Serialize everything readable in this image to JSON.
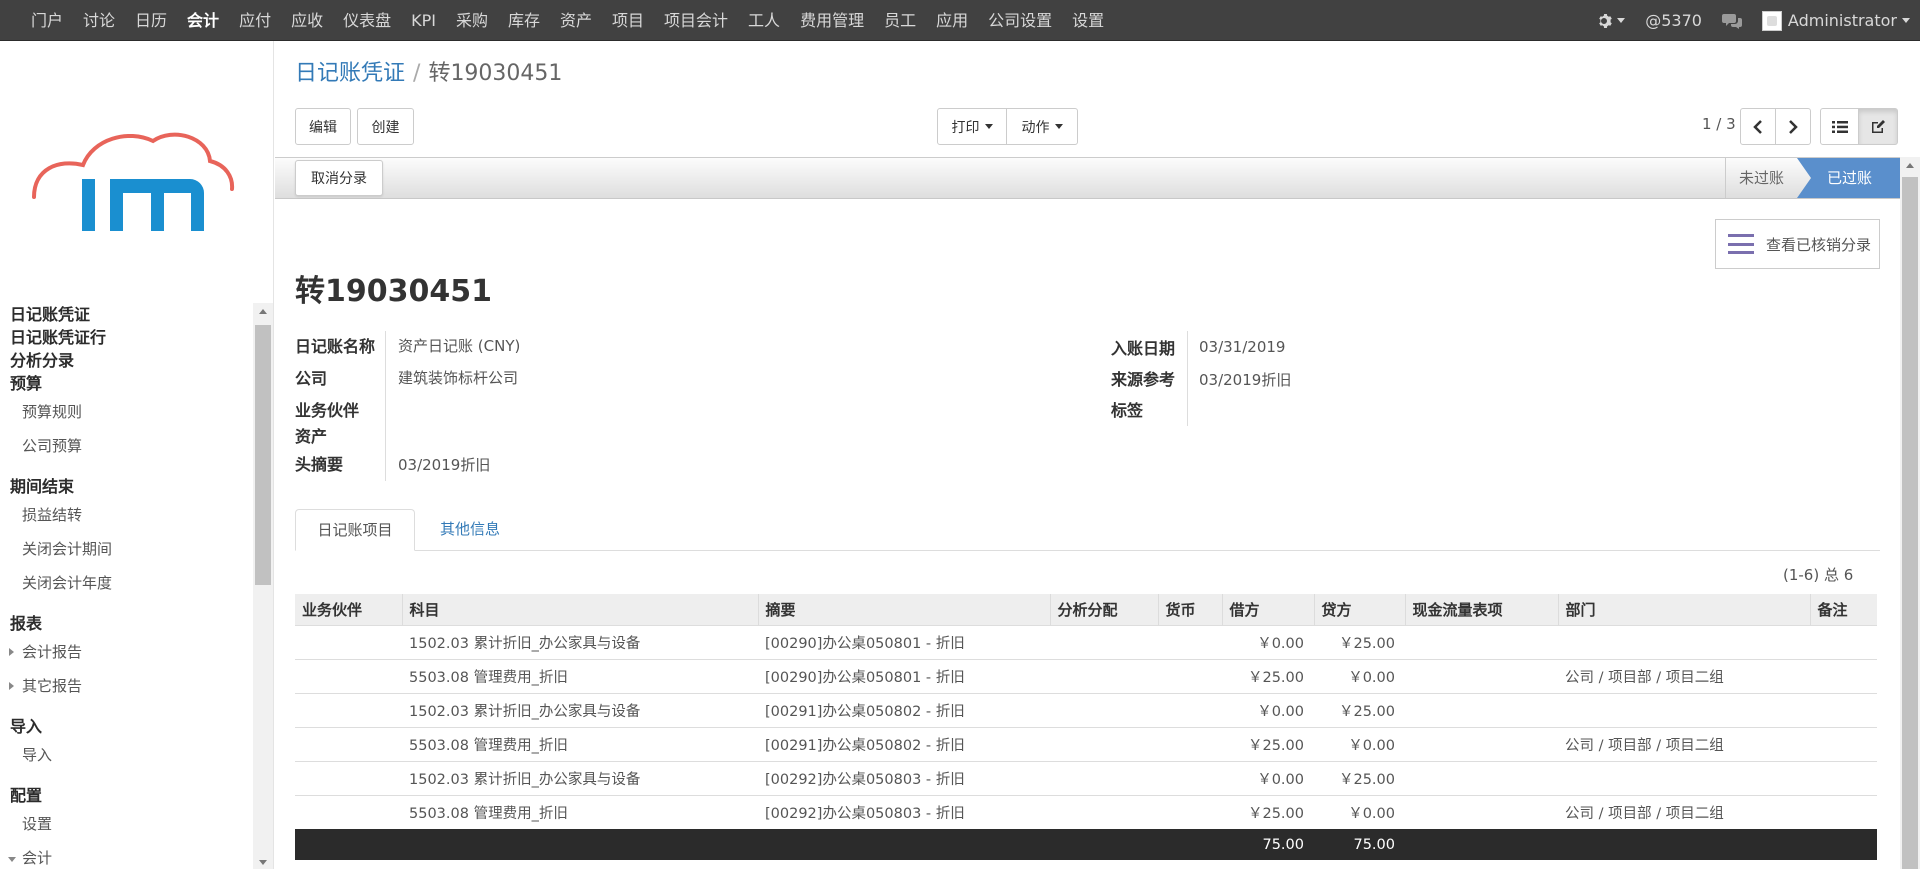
{
  "topnav": {
    "menu": [
      "门户",
      "讨论",
      "日历",
      "会计",
      "应付",
      "应收",
      "仪表盘",
      "KPI",
      "采购",
      "库存",
      "资产",
      "项目",
      "项目会计",
      "工人",
      "费用管理",
      "员工",
      "应用",
      "公司设置",
      "设置"
    ],
    "active": "会计",
    "notification_count": "@5370",
    "user": "Administrator"
  },
  "sidebar": {
    "items": [
      {
        "label": "日记账凭证",
        "type": "header"
      },
      {
        "label": "日记账凭证行",
        "type": "header"
      },
      {
        "label": "分析分录",
        "type": "header"
      },
      {
        "label": "预算",
        "type": "header"
      },
      {
        "label": "预算规则",
        "type": "item"
      },
      {
        "label": "公司预算",
        "type": "item"
      },
      {
        "label": "期间结束",
        "type": "header"
      },
      {
        "label": "损益结转",
        "type": "item"
      },
      {
        "label": "关闭会计期间",
        "type": "item"
      },
      {
        "label": "关闭会计年度",
        "type": "item"
      },
      {
        "label": "报表",
        "type": "header"
      },
      {
        "label": "会计报告",
        "type": "item"
      },
      {
        "label": "其它报告",
        "type": "item"
      },
      {
        "label": "导入",
        "type": "header"
      },
      {
        "label": "导入",
        "type": "item"
      },
      {
        "label": "配置",
        "type": "header"
      },
      {
        "label": "设置",
        "type": "item"
      },
      {
        "label": "会计",
        "type": "item"
      }
    ]
  },
  "breadcrumb": {
    "parent": "日记账凭证",
    "separator": "/",
    "current": "转19030451"
  },
  "toolbar": {
    "edit": "编辑",
    "create": "创建",
    "print": "打印",
    "action": "动作",
    "pager": "1 / 3"
  },
  "statusbar": {
    "unreconcile": "取消分录",
    "states": [
      "未过账",
      "已过账"
    ],
    "active_state": "已过账"
  },
  "sheet": {
    "reconciled_button": "查看已核销分录",
    "title": "转19030451",
    "left_fields": [
      {
        "label": "日记账名称",
        "value": "资产日记账 (CNY)"
      },
      {
        "label": "公司",
        "value": "建筑装饰标杆公司"
      },
      {
        "label": "业务伙伴",
        "value": ""
      },
      {
        "label": "资产",
        "value": ""
      },
      {
        "label": "头摘要",
        "value": "03/2019折旧"
      }
    ],
    "right_fields": [
      {
        "label": "入账日期",
        "value": "03/31/2019"
      },
      {
        "label": "来源参考",
        "value": "03/2019折旧"
      },
      {
        "label": "标签",
        "value": ""
      }
    ]
  },
  "tabs": [
    "日记账项目",
    "其他信息"
  ],
  "record_count": "(1-6) 总 6",
  "table": {
    "columns": [
      "业务伙伴",
      "科目",
      "摘要",
      "分析分配",
      "货币",
      "借方",
      "贷方",
      "现金流量表项",
      "部门",
      "备注"
    ],
    "rows": [
      [
        "",
        "1502.03 累计折旧_办公家具与设备",
        "[00290]办公桌050801 - 折旧",
        "",
        "",
        "￥0.00",
        "￥25.00",
        "",
        "",
        ""
      ],
      [
        "",
        "5503.08 管理费用_折旧",
        "[00290]办公桌050801 - 折旧",
        "",
        "",
        "￥25.00",
        "￥0.00",
        "",
        "公司 / 项目部 / 项目二组",
        ""
      ],
      [
        "",
        "1502.03 累计折旧_办公家具与设备",
        "[00291]办公桌050802 - 折旧",
        "",
        "",
        "￥0.00",
        "￥25.00",
        "",
        "",
        ""
      ],
      [
        "",
        "5503.08 管理费用_折旧",
        "[00291]办公桌050802 - 折旧",
        "",
        "",
        "￥25.00",
        "￥0.00",
        "",
        "公司 / 项目部 / 项目二组",
        ""
      ],
      [
        "",
        "1502.03 累计折旧_办公家具与设备",
        "[00292]办公桌050803 - 折旧",
        "",
        "",
        "￥0.00",
        "￥25.00",
        "",
        "",
        ""
      ],
      [
        "",
        "5503.08 管理费用_折旧",
        "[00292]办公桌050803 - 折旧",
        "",
        "",
        "￥25.00",
        "￥0.00",
        "",
        "公司 / 项目部 / 项目二组",
        ""
      ]
    ],
    "totals": {
      "debit": "75.00",
      "credit": "75.00"
    }
  },
  "colors": {
    "navbar": "#414141",
    "link": "#337ab7",
    "status_active": "#5a8fcc",
    "logo_red": "#e8645a",
    "logo_blue": "#1a8fd0"
  }
}
